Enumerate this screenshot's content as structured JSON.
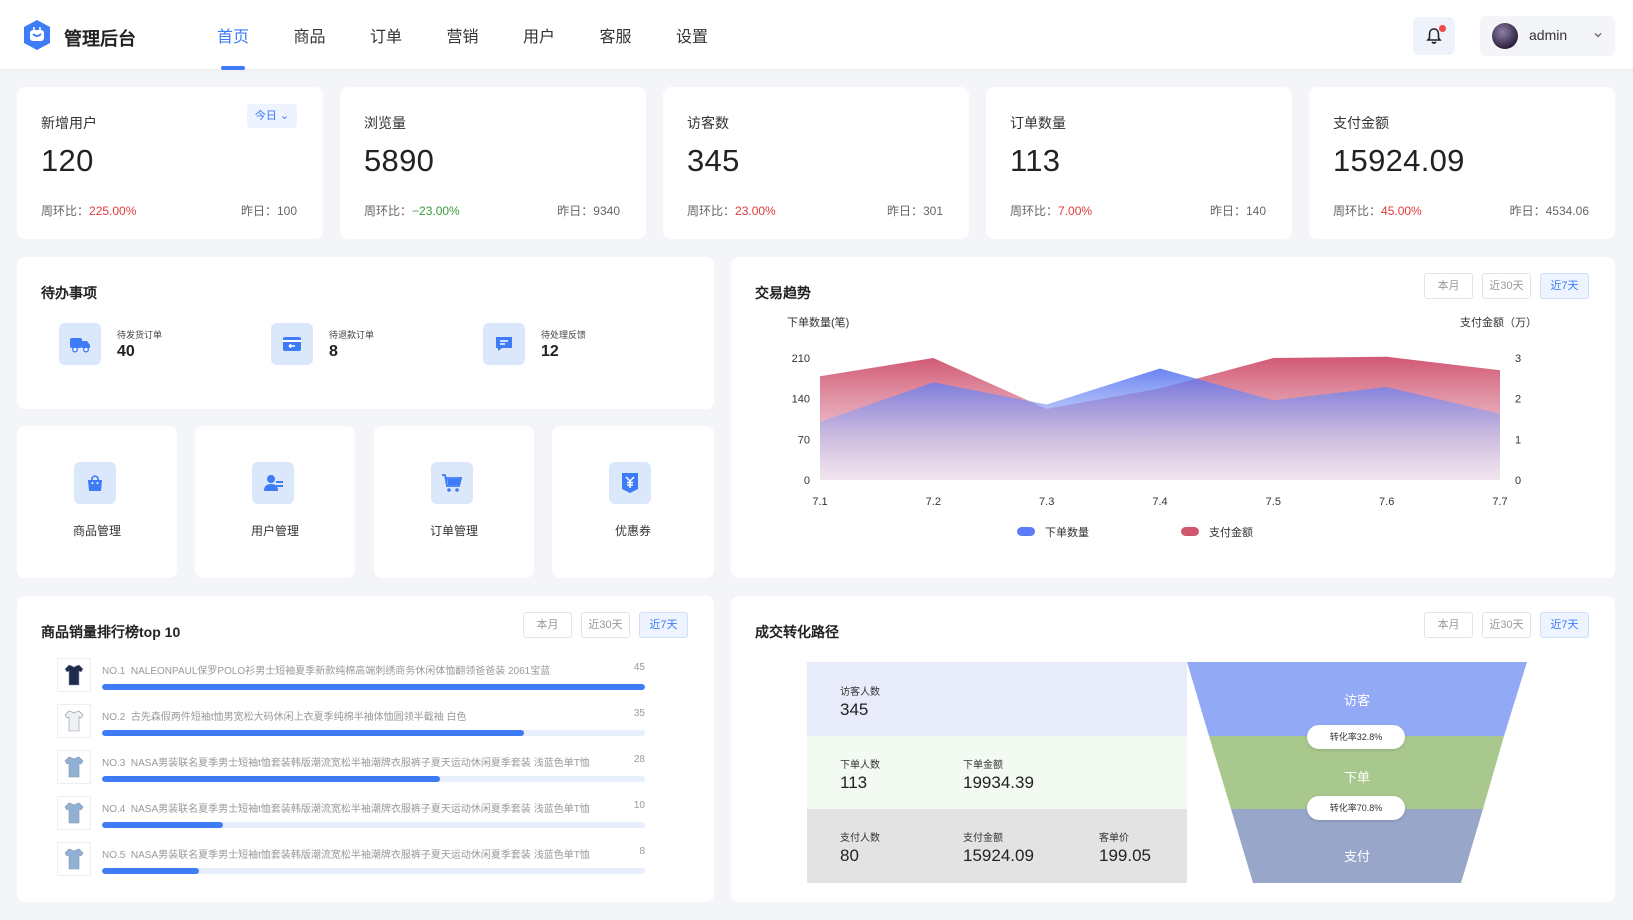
{
  "header": {
    "brand": "管理后台",
    "nav": [
      "首页",
      "商品",
      "订单",
      "营销",
      "用户",
      "客服",
      "设置"
    ],
    "active_nav": "首页",
    "user": "admin"
  },
  "stats": [
    {
      "title": "新增用户",
      "value": "120",
      "wow_label": "周环比：",
      "wow": "225.00%",
      "trend": "up",
      "yest": "昨日：100",
      "tag": "今日"
    },
    {
      "title": "浏览量",
      "value": "5890",
      "wow_label": "周环比：",
      "wow": "−23.00%",
      "trend": "down",
      "yest": "昨日：9340"
    },
    {
      "title": "访客数",
      "value": "345",
      "wow_label": "周环比：",
      "wow": "23.00%",
      "trend": "up",
      "yest": "昨日：301"
    },
    {
      "title": "订单数量",
      "value": "113",
      "wow_label": "周环比：",
      "wow": "7.00%",
      "trend": "up",
      "yest": "昨日：140"
    },
    {
      "title": "支付金额",
      "value": "15924.09",
      "wow_label": "周环比：",
      "wow": "45.00%",
      "trend": "up",
      "yest": "昨日：4534.06"
    }
  ],
  "todo": {
    "title": "待办事项",
    "items": [
      {
        "label": "待发货订单",
        "count": "40",
        "icon": "truck-icon"
      },
      {
        "label": "待退款订单",
        "count": "8",
        "icon": "refund-icon"
      },
      {
        "label": "待处理反馈",
        "count": "12",
        "icon": "message-icon"
      }
    ]
  },
  "quick": [
    {
      "label": "商品管理",
      "icon": "shopping-bag-icon"
    },
    {
      "label": "用户管理",
      "icon": "user-manage-icon"
    },
    {
      "label": "订单管理",
      "icon": "cart-icon"
    },
    {
      "label": "优惠券",
      "icon": "coupon-icon"
    }
  ],
  "range_tabs": [
    "本月",
    "近30天",
    "近7天"
  ],
  "trend": {
    "title": "交易趋势",
    "left_axis": "下单数量(笔)",
    "right_axis": "支付金额（万）",
    "legend": [
      "下单数量",
      "支付金额"
    ]
  },
  "chart_data": {
    "type": "area",
    "x": [
      "7.1",
      "7.2",
      "7.3",
      "7.4",
      "7.5",
      "7.6",
      "7.7"
    ],
    "y_left_ticks": [
      "0",
      "70",
      "140",
      "210"
    ],
    "y_right_ticks": [
      "0",
      "1",
      "2",
      "3"
    ],
    "ylim_left": [
      0,
      210
    ],
    "ylim_right": [
      0,
      3
    ],
    "series": [
      {
        "name": "下单数量",
        "axis": "left",
        "color": "#5b7cf6",
        "values": [
          100,
          168,
          130,
          192,
          137,
          160,
          114
        ]
      },
      {
        "name": "支付金额",
        "axis": "right",
        "color": "#d2566f",
        "values": [
          2.55,
          3.0,
          1.75,
          2.25,
          3.0,
          3.03,
          2.7
        ]
      }
    ]
  },
  "ranking": {
    "title": "商品销量排行榜top 10",
    "items": [
      {
        "no": "NO.1",
        "name": "NALEONPAUL保罗POLO衫男士短袖夏季新款纯棉高端刺绣商务休闲体恤翻领爸爸装 2061宝蓝",
        "count": "45",
        "ratio": 1.0
      },
      {
        "no": "NO.2",
        "name": "古先森假两件短袖t恤男宽松大码休闲上衣夏季纯棉半袖体恤圆领半截袖 白色",
        "count": "35",
        "ratio": 0.778
      },
      {
        "no": "NO.3",
        "name": "NASA男装联名夏季男士短袖t恤套装韩版潮流宽松半袖潮牌衣服裤子夏天运动休闲夏季套装 浅蓝色单T恤",
        "count": "28",
        "ratio": 0.622
      },
      {
        "no": "NO.4",
        "name": "NASA男装联名夏季男士短袖t恤套装韩版潮流宽松半袖潮牌衣服裤子夏天运动休闲夏季套装 浅蓝色单T恤",
        "count": "10",
        "ratio": 0.222
      },
      {
        "no": "NO.5",
        "name": "NASA男装联名夏季男士短袖t恤套装韩版潮流宽松半袖潮牌衣服裤子夏天运动休闲夏季套装 浅蓝色单T恤",
        "count": "8",
        "ratio": 0.178
      }
    ]
  },
  "funnel": {
    "title": "成交转化路径",
    "visitors_label": "访客人数",
    "visitors": "345",
    "orders_label": "下单人数",
    "orders": "113",
    "order_amount_label": "下单金额",
    "order_amount": "19934.39",
    "payers_label": "支付人数",
    "payers": "80",
    "pay_amount_label": "支付金额",
    "pay_amount": "15924.09",
    "unit_price_label": "客单价",
    "unit_price": "199.05",
    "stages": [
      "访客",
      "下单",
      "支付"
    ],
    "rate1": "转化率32.8%",
    "rate2": "转化率70.8%"
  }
}
